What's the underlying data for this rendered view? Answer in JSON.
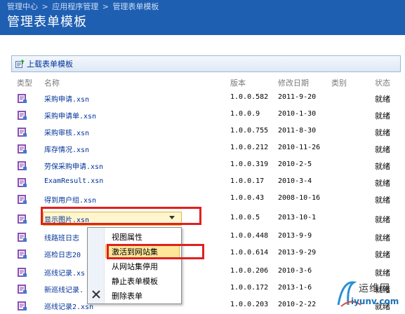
{
  "header": {
    "breadcrumb": [
      "管理中心",
      ">",
      "应用程序管理",
      ">",
      "管理表单模板"
    ],
    "title": "管理表单模板"
  },
  "toolbar": {
    "upload_label": "上载表单模板"
  },
  "columns": {
    "type": "类型",
    "name": "名称",
    "version": "版本",
    "modified": "修改日期",
    "category": "类别",
    "status": "状态"
  },
  "rows": [
    {
      "name": "采购申请.xsn",
      "version": "1.0.0.582",
      "date": "2011-9-20",
      "status": "就绪"
    },
    {
      "name": "采购申请单.xsn",
      "version": "1.0.0.9",
      "date": "2010-1-30",
      "status": "就绪"
    },
    {
      "name": "采购审核.xsn",
      "version": "1.0.0.755",
      "date": "2011-8-30",
      "status": "就绪"
    },
    {
      "name": "库存情况.xsn",
      "version": "1.0.0.212",
      "date": "2010-11-26",
      "status": "就绪"
    },
    {
      "name": "劳保采购申请.xsn",
      "version": "1.0.0.319",
      "date": "2010-2-5",
      "status": "就绪"
    },
    {
      "name": "ExamResult.xsn",
      "version": "1.0.0.17",
      "date": "2010-3-4",
      "status": "就绪"
    },
    {
      "name": "得到用户组.xsn",
      "version": "1.0.0.43",
      "date": "2008-10-16",
      "status": "就绪"
    },
    {
      "name": "显示图片.xsn",
      "version": "1.0.0.5",
      "date": "2013-10-1",
      "status": "就绪"
    },
    {
      "name": "线路班日志",
      "version": "1.0.0.448",
      "date": "2013-9-9",
      "status": "就绪"
    },
    {
      "name": "巡检日志20",
      "version": "1.0.0.614",
      "date": "2013-9-29",
      "status": "就绪"
    },
    {
      "name": "巡线记录.xs",
      "version": "1.0.0.206",
      "date": "2010-3-6",
      "status": "就绪"
    },
    {
      "name": "新巡线记录.",
      "version": "1.0.0.172",
      "date": "2013-1-6",
      "status": "就绪"
    },
    {
      "name": "巡线记录2.xsn",
      "version": "1.0.0.203",
      "date": "2010-2-22",
      "status": "就绪"
    }
  ],
  "context_menu": {
    "items": [
      "视图属性",
      "激活到网站集",
      "从网站集停用",
      "静止表单模板",
      "删除表单"
    ]
  },
  "watermark": {
    "line1": "运维网",
    "line2": "iyunv.com"
  },
  "colors": {
    "header_bg": "#1f5fb2",
    "link": "#003399",
    "highlight_border": "#e0201f"
  }
}
